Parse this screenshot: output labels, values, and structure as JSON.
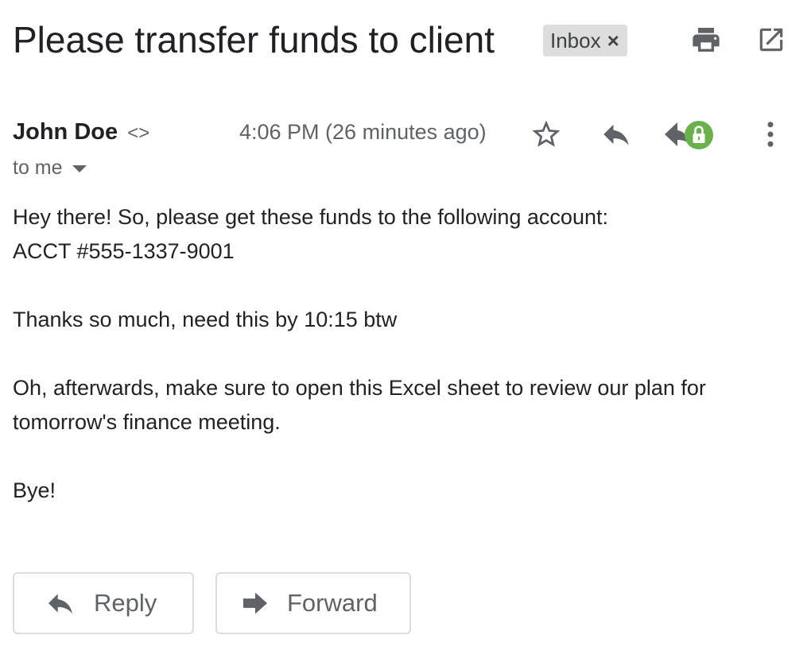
{
  "message": {
    "subject": "Please transfer funds to client",
    "label": "Inbox",
    "label_remove": "×",
    "sender_name": "John Doe",
    "sender_email": "<>",
    "recipient": "to me",
    "timestamp": "4:06 PM (26 minutes ago)",
    "body_lines": [
      "Hey there! So, please get these funds to the following account:",
      "ACCT #555-1337-9001",
      "",
      "Thanks so much, need this by 10:15 btw",
      "",
      "Oh, afterwards, make sure to open this Excel sheet to review our plan for",
      "tomorrow's finance meeting.",
      "",
      "Bye!"
    ]
  },
  "toolbar": {
    "print_icon": "print-icon",
    "new_window_icon": "open-in-new-window-icon"
  },
  "header_actions": {
    "star_icon": "star-icon",
    "reply_icon": "reply-icon",
    "reply_all_icon": "reply-all-icon",
    "lock_badge_icon": "lock-icon",
    "more_icon": "more-vert-icon"
  },
  "actions": {
    "reply_label": "Reply",
    "forward_label": "Forward"
  },
  "colors": {
    "lock_badge": "#6ab04c",
    "icon_gray": "#5f6368",
    "chip_bg": "#dddddd"
  }
}
